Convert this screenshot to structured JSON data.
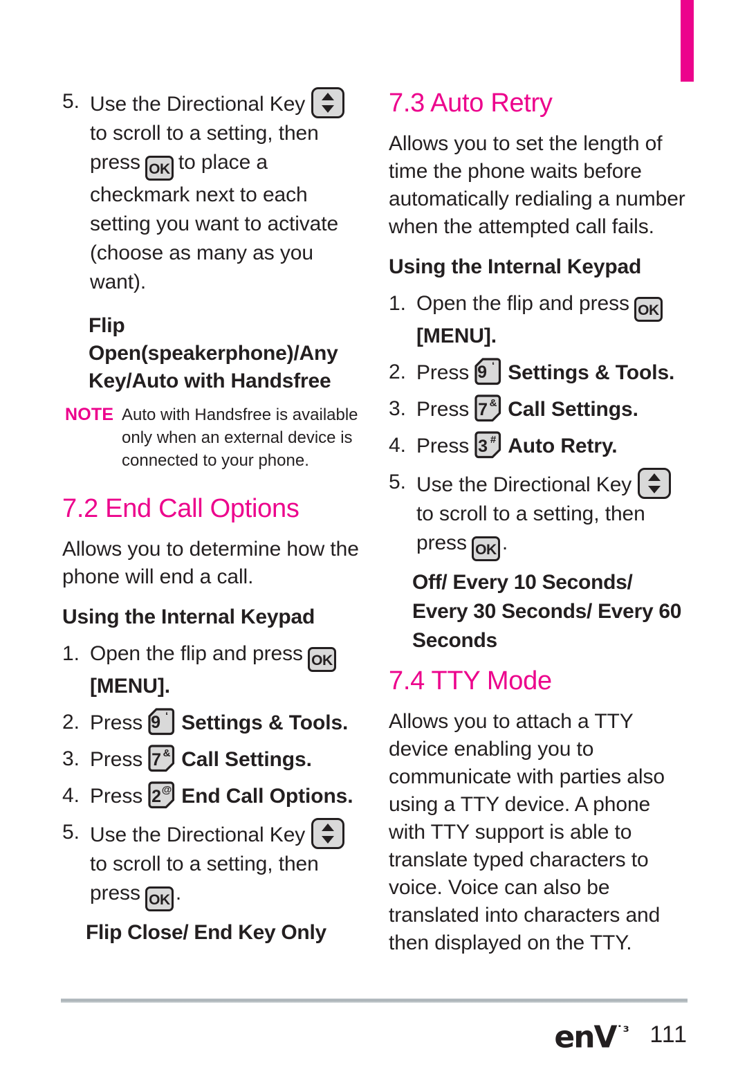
{
  "page": {
    "number": "111",
    "logo": {
      "text": "enV",
      "superscript": "˙³"
    },
    "accent_color": "#ec038c",
    "text_color": "#231f20",
    "tab_marker_color": "#ec038c"
  },
  "icons": {
    "ok_key_label": "OK",
    "directional_key_name": "directional-key",
    "key_9": {
      "digit": "9",
      "superscript": "‘"
    },
    "key_7": {
      "digit": "7",
      "superscript": "&"
    },
    "key_2": {
      "digit": "2",
      "superscript": "@"
    },
    "key_3": {
      "digit": "3",
      "superscript": "#"
    }
  },
  "left_column": {
    "step5": {
      "number": "5.",
      "part1": "Use the Directional Key",
      "part2": "to scroll to a setting, then press",
      "part3": "to place a checkmark next to each setting you want to activate (choose as many as you want)."
    },
    "subheading_flip": "Flip Open(speakerphone)/Any Key/Auto with Handsfree",
    "note": {
      "label": "NOTE",
      "text": "Auto with Handsfree is available only when an external device is connected to your phone."
    },
    "section": {
      "heading": "7.2 End Call Options",
      "intro": "Allows you to determine how the phone will end a call.",
      "keypad_heading": "Using the Internal Keypad",
      "steps": [
        {
          "number": "1.",
          "before": "Open the flip and press",
          "after": "[MENU]."
        },
        {
          "number": "2.",
          "before": "Press",
          "key": "9",
          "after": "Settings & Tools."
        },
        {
          "number": "3.",
          "before": "Press",
          "key": "7",
          "after": "Call Settings."
        },
        {
          "number": "4.",
          "before": "Press",
          "key": "2",
          "after": "End Call Options."
        }
      ],
      "step5": {
        "number": "5.",
        "part1": "Use the Directional Key",
        "part2": "to scroll to a setting, then press",
        "part3": "."
      },
      "options": "Flip Close/ End Key Only"
    }
  },
  "right_column": {
    "section73": {
      "heading": "7.3 Auto Retry",
      "intro": "Allows you to set the length of time the phone waits before automatically redialing a number when the attempted call fails.",
      "keypad_heading": "Using the Internal Keypad",
      "steps": [
        {
          "number": "1.",
          "before": "Open the flip and press",
          "after": "[MENU]."
        },
        {
          "number": "2.",
          "before": "Press",
          "key": "9",
          "after": "Settings & Tools."
        },
        {
          "number": "3.",
          "before": "Press",
          "key": "7",
          "after": "Call Settings."
        },
        {
          "number": "4.",
          "before": "Press",
          "key": "3",
          "after": "Auto Retry."
        }
      ],
      "step5": {
        "number": "5.",
        "part1": "Use the Directional Key",
        "part2": "to scroll to a setting, then press",
        "part3": "."
      },
      "options": "Off/ Every 10 Seconds/ Every 30 Seconds/ Every 60 Seconds"
    },
    "section74": {
      "heading": "7.4 TTY Mode",
      "intro": "Allows you to attach a TTY device enabling you to communicate with parties also using a TTY device. A phone with TTY support is able to translate typed characters to voice. Voice can also be translated into characters and then displayed on the TTY."
    }
  }
}
